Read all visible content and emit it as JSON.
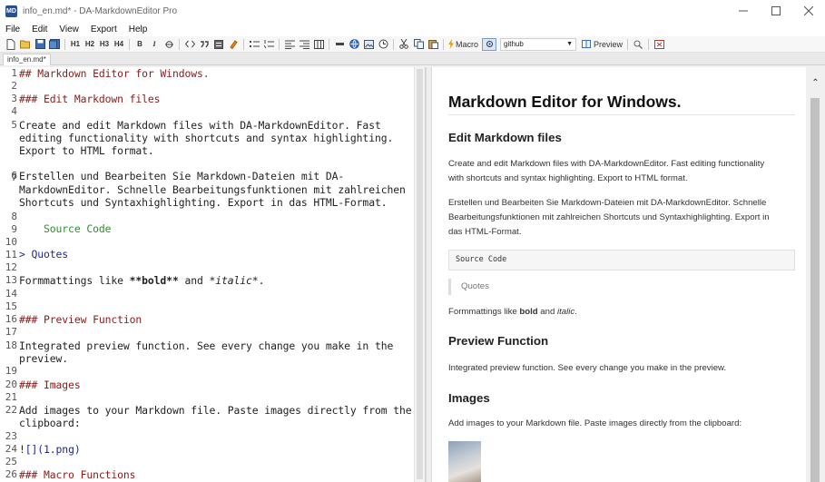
{
  "window": {
    "title": "info_en.md* - DA-MarkdownEditor Pro",
    "icon": "MD"
  },
  "menu": [
    "File",
    "Edit",
    "View",
    "Export",
    "Help"
  ],
  "toolbar": {
    "h1": "H1",
    "h2": "H2",
    "h3": "H3",
    "h4": "H4",
    "bold": "B",
    "italic": "I",
    "macro_label": "Macro",
    "style_value": "github",
    "preview_label": "Preview"
  },
  "tab": {
    "label": "info_en.md*"
  },
  "editor": {
    "gutter": [
      "1",
      "2",
      "3",
      "4",
      "5",
      "",
      "",
      "6",
      "7",
      "",
      "",
      "8",
      "9",
      "10",
      "11",
      "12",
      "13",
      "14",
      "15",
      "16",
      "17",
      "18",
      "",
      "19",
      "20",
      "21",
      "22",
      "",
      "23",
      "24",
      "25",
      "26"
    ],
    "lines": {
      "l1": "## Markdown Editor for Windows.",
      "l3": "### Edit Markdown files",
      "l5a": "Create and edit Markdown files with DA-MarkdownEditor. Fast",
      "l5b": "editing functionality with shortcuts and syntax highlighting.",
      "l5c": "Export to HTML format.",
      "l7a": "Erstellen und Bearbeiten Sie Markdown-Dateien mit DA-",
      "l7b": "MarkdownEditor. Schnelle Bearbeitungsfunktionen mit zahlreichen",
      "l7c": "Shortcuts und Syntaxhighlighting. Export in das HTML-Format.",
      "l9": "    Source Code",
      "l11": "> Quotes",
      "l13_pre": "Formmattings like ",
      "l13_bold": "**bold**",
      "l13_mid": " and ",
      "l13_italic": "*italic*",
      "l13_post": ".",
      "l16": "### Preview Function",
      "l18a": "Integrated preview function. See every change you make in the",
      "l18b": "preview.",
      "l20": "### Images",
      "l22a": "Add images to your Markdown file. Paste images directly from the",
      "l22b": "clipboard:",
      "l24_pre": "!",
      "l24_link": "[](1.png)",
      "l26": "### Macro Functions"
    }
  },
  "preview": {
    "h1": "Markdown Editor for Windows.",
    "h3_edit": "Edit Markdown files",
    "p1a": "Create and edit Markdown files with DA-MarkdownEditor. Fast editing functionality",
    "p1b": "with shortcuts and syntax highlighting. Export to HTML format.",
    "p2a": "Erstellen und Bearbeiten Sie Markdown-Dateien mit DA-MarkdownEditor. Schnelle",
    "p2b": "Bearbeitungsfunktionen mit zahlreichen Shortcuts und Syntaxhighlighting. Export in",
    "p2c": "das HTML-Format.",
    "code": "Source Code",
    "quote": "Quotes",
    "fmt_pre": "Formmattings like ",
    "fmt_bold": "bold",
    "fmt_mid": " and ",
    "fmt_italic": "italic",
    "fmt_post": ".",
    "h3_preview": "Preview Function",
    "p_preview": "Integrated preview function. See every change you make in the preview.",
    "h3_images": "Images",
    "p_images": "Add images to your Markdown file. Paste images directly from the clipboard:"
  }
}
